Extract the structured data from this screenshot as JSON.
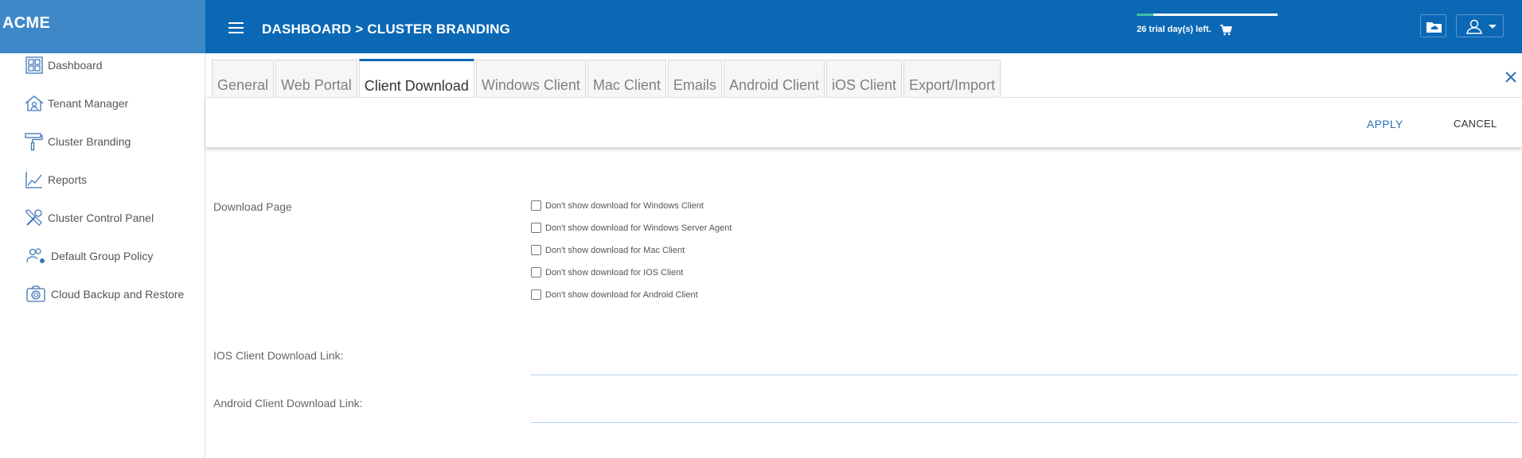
{
  "app": {
    "brand": "ACME"
  },
  "header": {
    "breadcrumb": "DASHBOARD > CLUSTER BRANDING",
    "trial_text": "26 trial day(s) left.",
    "trial_progress": 0.12
  },
  "sidebar": {
    "items": [
      {
        "label": "Dashboard",
        "icon": "dashboard-icon"
      },
      {
        "label": "Tenant Manager",
        "icon": "tenant-house-icon"
      },
      {
        "label": "Cluster Branding",
        "icon": "paint-roller-icon"
      },
      {
        "label": "Reports",
        "icon": "chart-icon"
      },
      {
        "label": "Cluster Control Panel",
        "icon": "tools-icon"
      },
      {
        "label": "Default Group Policy",
        "icon": "users-gear-icon"
      },
      {
        "label": "Cloud Backup and Restore",
        "icon": "camera-icon"
      }
    ]
  },
  "tabs": [
    {
      "label": "General"
    },
    {
      "label": "Web Portal"
    },
    {
      "label": "Client Download",
      "active": true
    },
    {
      "label": "Windows Client"
    },
    {
      "label": "Mac Client"
    },
    {
      "label": "Emails"
    },
    {
      "label": "Android Client"
    },
    {
      "label": "iOS Client"
    },
    {
      "label": "Export/Import"
    }
  ],
  "actions": {
    "apply": "APPLY",
    "cancel": "CANCEL"
  },
  "form": {
    "download_page_label": "Download Page",
    "checkboxes": [
      {
        "label": "Don't show download for Windows Client",
        "checked": false
      },
      {
        "label": "Don't show download for Windows Server Agent",
        "checked": false
      },
      {
        "label": "Don't show download for Mac Client",
        "checked": false
      },
      {
        "label": "Don't show download for IOS Client",
        "checked": false
      },
      {
        "label": "Don't show download for Android Client",
        "checked": false
      }
    ],
    "ios_link_label": "IOS Client Download Link:",
    "ios_link_value": "",
    "android_link_label": "Android Client Download Link:",
    "android_link_value": ""
  },
  "colors": {
    "header": "#0b68b5",
    "brand_bg": "#3f88c8",
    "accent": "#2f6fb6"
  }
}
